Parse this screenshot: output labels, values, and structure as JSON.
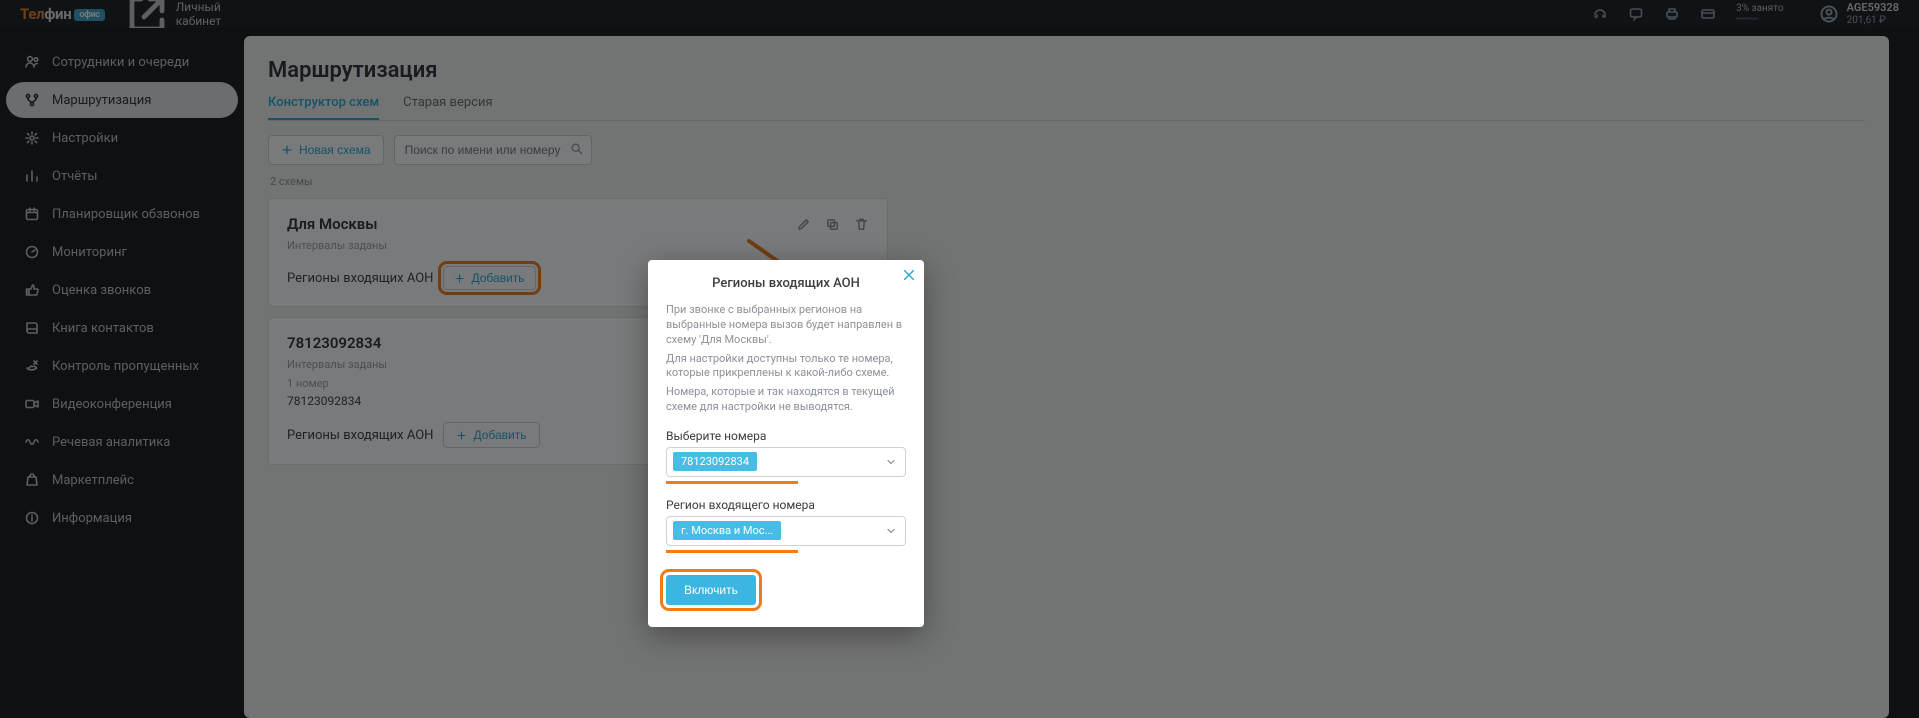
{
  "brand": {
    "tel": "Тел",
    "fin": "фин",
    "badge": "офис"
  },
  "topbar": {
    "cabinet": "Личный кабинет",
    "busy_pct": "3% занято",
    "busy_bar": "━━━━━"
  },
  "account": {
    "name": "AGE59328",
    "balance": "201,61 ₽"
  },
  "sidebar": [
    {
      "icon": "users",
      "label": "Сотрудники и очереди"
    },
    {
      "icon": "routing",
      "label": "Маршрутизация",
      "active": true
    },
    {
      "icon": "gear",
      "label": "Настройки"
    },
    {
      "icon": "bars",
      "label": "Отчёты"
    },
    {
      "icon": "calendar",
      "label": "Планировщик обзвонов"
    },
    {
      "icon": "monitor",
      "label": "Мониторинг"
    },
    {
      "icon": "thumb",
      "label": "Оценка звонков"
    },
    {
      "icon": "book",
      "label": "Книга контактов"
    },
    {
      "icon": "phone-missed",
      "label": "Контроль пропущенных"
    },
    {
      "icon": "video",
      "label": "Видеоконференция"
    },
    {
      "icon": "wave",
      "label": "Речевая аналитика"
    },
    {
      "icon": "bag",
      "label": "Маркетплейс"
    },
    {
      "icon": "info",
      "label": "Информация"
    }
  ],
  "page": {
    "title": "Маршрутизация"
  },
  "tabs": [
    {
      "label": "Конструктор схем",
      "active": true
    },
    {
      "label": "Старая версия"
    }
  ],
  "toolbar": {
    "new_scheme": "Новая схема",
    "search_placeholder": "Поиск по имени или номеру"
  },
  "list": {
    "count": "2 схемы"
  },
  "cards": [
    {
      "title": "Для Москвы",
      "intervals": "Интервалы заданы",
      "regions_label": "Регионы входящих АОН",
      "add_label": "Добавить",
      "highlight_add": true,
      "show_actions": true
    },
    {
      "title": "78123092834",
      "intervals": "Интервалы заданы",
      "num_count": "1 номер",
      "number": "78123092834",
      "regions_label": "Регионы входящих АОН",
      "add_label": "Добавить"
    }
  ],
  "modal": {
    "title": "Регионы входящих АОН",
    "p1": "При звонке с выбранных регионов на выбранные номера вызов будет направлен в схему 'Для Москвы'.",
    "p2": "Для настройки доступны только те номера, которые прикреплены к какой-либо схеме.",
    "p3": "Номера, которые и так находятся в текущей схеме для настройки не выводятся.",
    "numbers_label": "Выберите номера",
    "number_chip": "78123092834",
    "region_label": "Регион входящего номера",
    "region_chip": "г. Москва и Мос...",
    "submit": "Включить"
  }
}
